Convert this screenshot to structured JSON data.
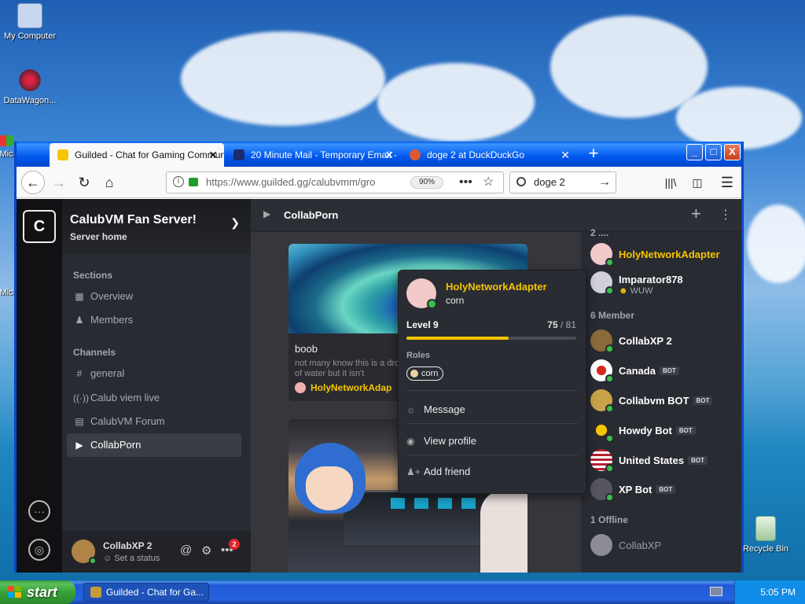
{
  "desktop": {
    "icons": [
      {
        "label": "My Computer",
        "icon": "computer-icon"
      },
      {
        "label": "DataWagon...",
        "icon": "datawagon-icon"
      },
      {
        "label": "Mic",
        "icon": "partial-icon"
      },
      {
        "label": "Mic",
        "icon": "partial-icon"
      },
      {
        "label": "Recycle Bin",
        "icon": "recycle-bin-icon"
      }
    ]
  },
  "taskbar": {
    "start_label": "start",
    "task_label": "Guilded - Chat for Ga...",
    "clock": "5:05 PM"
  },
  "browser": {
    "tabs": [
      {
        "label": "Guilded - Chat for Gaming Commun",
        "icon": "guilded-icon",
        "active": true
      },
      {
        "label": "20 Minute Mail - Temporary Email -",
        "icon": "bowtie-icon",
        "active": false
      },
      {
        "label": "doge 2 at DuckDuckGo",
        "icon": "duckduckgo-icon",
        "active": false
      }
    ],
    "url": "https://www.guilded.gg/calubvmm/gro",
    "zoom": "90%",
    "search_query": "doge 2",
    "window_buttons": {
      "minimize": "_",
      "maximize": "□",
      "close": "X"
    }
  },
  "server": {
    "logo_letter": "C",
    "name": "CalubVM Fan Server!",
    "subtitle": "Server home",
    "sections_label": "Sections",
    "sections": [
      {
        "label": "Overview",
        "icon": "grid-icon"
      },
      {
        "label": "Members",
        "icon": "members-icon"
      }
    ],
    "channels_label": "Channels",
    "channels": [
      {
        "label": "general",
        "icon": "hash-icon",
        "selected": false
      },
      {
        "label": "Calub viem live",
        "icon": "stream-icon",
        "selected": false
      },
      {
        "label": "CalubVM Forum",
        "icon": "forum-icon",
        "selected": false
      },
      {
        "label": "CollabPorn",
        "icon": "media-icon",
        "selected": true
      }
    ]
  },
  "current_user": {
    "name": "CollabXP 2",
    "status": "Set a status",
    "notification_count": "2"
  },
  "channel": {
    "title": "CollabPorn",
    "post": {
      "title": "boob",
      "body": "not many know this is a drop of water but it isn't",
      "author": "HolyNetworkAdap"
    }
  },
  "members": {
    "partial_group": "2 ....",
    "admins": [
      {
        "name": "HolyNetworkAdapter",
        "gold": true
      },
      {
        "name": "Imparator878",
        "sub": "WUW",
        "gold": false
      }
    ],
    "member_group": "6 Member",
    "list": [
      {
        "name": "CollabXP 2",
        "bot": false,
        "avatar": "#8a6a3a"
      },
      {
        "name": "Canada",
        "bot": true,
        "avatar": "#ffffff"
      },
      {
        "name": "Collabvm BOT",
        "bot": true,
        "avatar": "#c9a34a"
      },
      {
        "name": "Howdy Bot",
        "bot": true,
        "avatar": "#2a2a30"
      },
      {
        "name": "United States",
        "bot": true,
        "avatar": "#b22234"
      },
      {
        "name": "XP Bot",
        "bot": true,
        "avatar": "#555560"
      }
    ],
    "bot_tag": "BOT",
    "offline_group": "1 Offline",
    "offline": [
      {
        "name": "CollabXP"
      }
    ]
  },
  "popup": {
    "name": "HolyNetworkAdapter",
    "subtitle": "corn",
    "level": "Level 9",
    "xp_current": "75",
    "xp_sep": " / 81",
    "xp_fraction": 0.6,
    "roles_label": "Roles",
    "role": "corn",
    "actions": [
      {
        "label": "Message",
        "icon": "message-icon"
      },
      {
        "label": "View profile",
        "icon": "profile-icon"
      },
      {
        "label": "Add friend",
        "icon": "add-friend-icon"
      }
    ]
  }
}
